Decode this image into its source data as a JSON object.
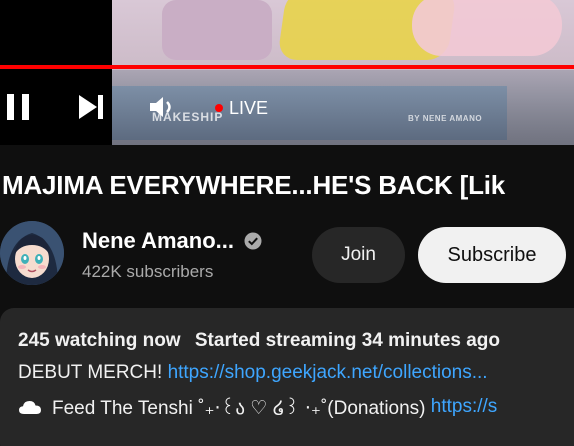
{
  "player": {
    "live_label": "LIVE",
    "watermark_left": "MAKESHIP",
    "watermark_right": "BY NENE AMANO",
    "progress_color": "#ff0000",
    "controls": [
      "pause-icon",
      "next-icon",
      "volume-icon"
    ]
  },
  "video": {
    "title": "MAJIMA EVERYWHERE...HE'S BACK [Lik"
  },
  "channel": {
    "name": "Nene Amano...",
    "verified_icon": "check-circle-icon",
    "subscribers": "422K subscribers"
  },
  "actions": {
    "join_label": "Join",
    "subscribe_label": "Subscribe"
  },
  "description": {
    "watching": "245 watching now",
    "started": "Started streaming 34 minutes ago",
    "merch_text": "DEBUT MERCH! ",
    "merch_link": "https://shop.geekjack.net/collections...",
    "donate_text": "Feed The Tenshi ˚₊‧꒰ა ♡ ໒꒱ ‧₊˚(Donations) ",
    "donate_link": "https://s",
    "donate_icon": "cloud-icon"
  },
  "colors": {
    "background": "#0f0f0f",
    "accent_red": "#ff0000",
    "link": "#3ea6ff",
    "card": "#272727"
  }
}
